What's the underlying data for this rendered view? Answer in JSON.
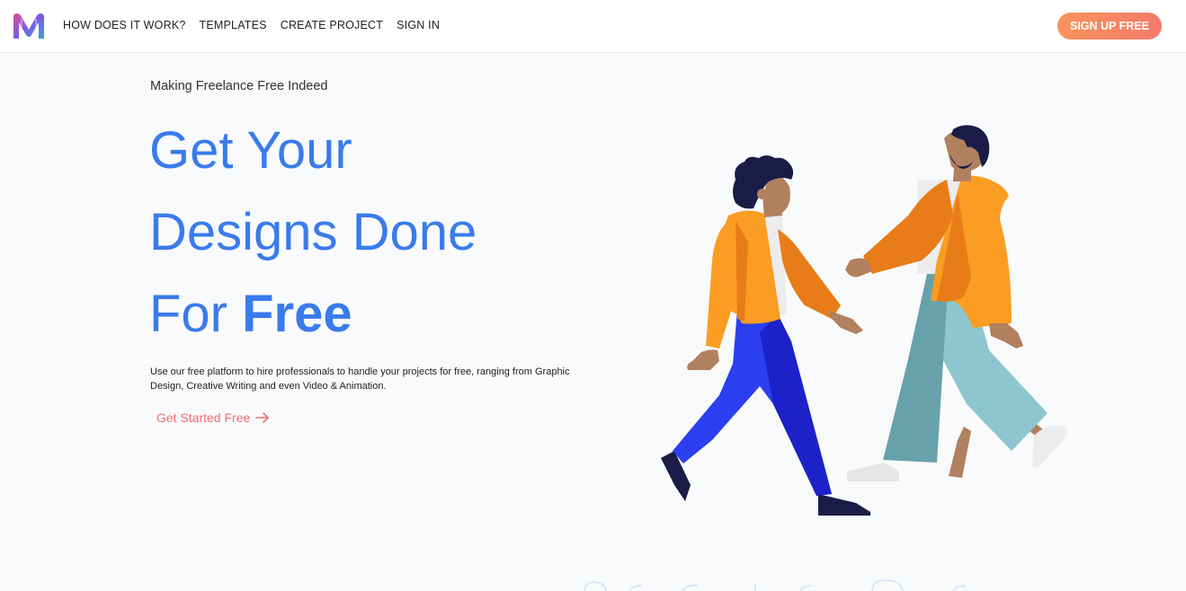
{
  "nav": {
    "links": [
      "HOW DOES IT WORK?",
      "TEMPLATES",
      "CREATE PROJECT",
      "SIGN IN"
    ],
    "signup_label": "SIGN UP FREE"
  },
  "hero": {
    "tagline": "Making Freelance Free Indeed",
    "headline_line1": "Get Your",
    "headline_line2": "Designs Done",
    "headline_line3_regular": "For ",
    "headline_line3_bold": "Free",
    "description": "Use our free platform to hire professionals to handle your projects for free, ranging from Graphic Design, Creative Writing and even Video & Animation.",
    "cta_label": "Get Started Free"
  },
  "colors": {
    "accent_blue": "#3a7bec",
    "cta_red": "#ef6d6d",
    "signup_gradient_start": "#f8935a",
    "signup_gradient_end": "#f47a6c"
  },
  "icons": [
    "logo-icon",
    "arrow-right-icon"
  ]
}
